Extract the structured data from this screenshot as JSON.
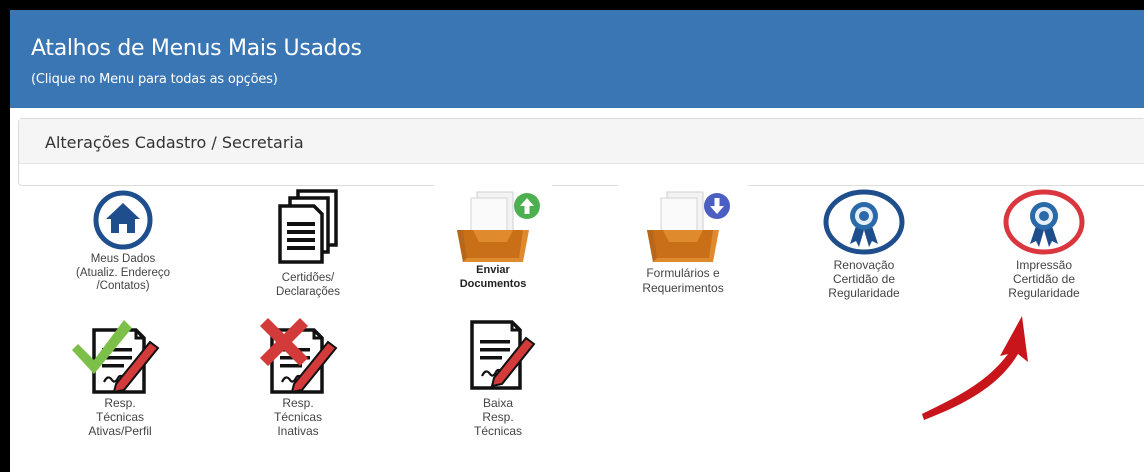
{
  "header": {
    "title": "Atalhos de Menus Mais Usados",
    "subtitle": "(Clique no Menu para todas as opções)"
  },
  "section": {
    "title": "Alterações Cadastro / Secretaria"
  },
  "tiles": {
    "meus_dados": "Meus Dados\n(Atualiz. Endereço\n/Contatos)",
    "certidoes": "Certidões/\nDeclarações",
    "enviar": "Enviar\nDocumentos",
    "formularios": "Formulários e\nRequerimentos",
    "renovacao": "Renovação\nCertidão de\nRegularidade",
    "impressao": "Impressão\nCertidão de\nRegularidade",
    "resp_ativas": "Resp.\nTécnicas\nAtivas/Perfil",
    "resp_inativas": "Resp.\nTécnicas\nInativas",
    "baixa": "Baixa\nResp.\nTécnicas"
  },
  "colors": {
    "header_bg": "#3a76b3",
    "icon_blue": "#1f4e8c",
    "impressao_ring": "#d9363e",
    "tray_orange": "#e08a2e",
    "upload_green": "#4caf50",
    "download_blue": "#4a5fc1",
    "check_green": "#7cc04a",
    "cross_red": "#d33a3a",
    "arrow_red": "#c8151b"
  },
  "icons": [
    "home-icon",
    "documents-icon",
    "upload-tray-icon",
    "download-tray-icon",
    "award-ribbon-icon",
    "checked-signed-document-icon",
    "crossed-signed-document-icon",
    "signed-document-icon"
  ]
}
